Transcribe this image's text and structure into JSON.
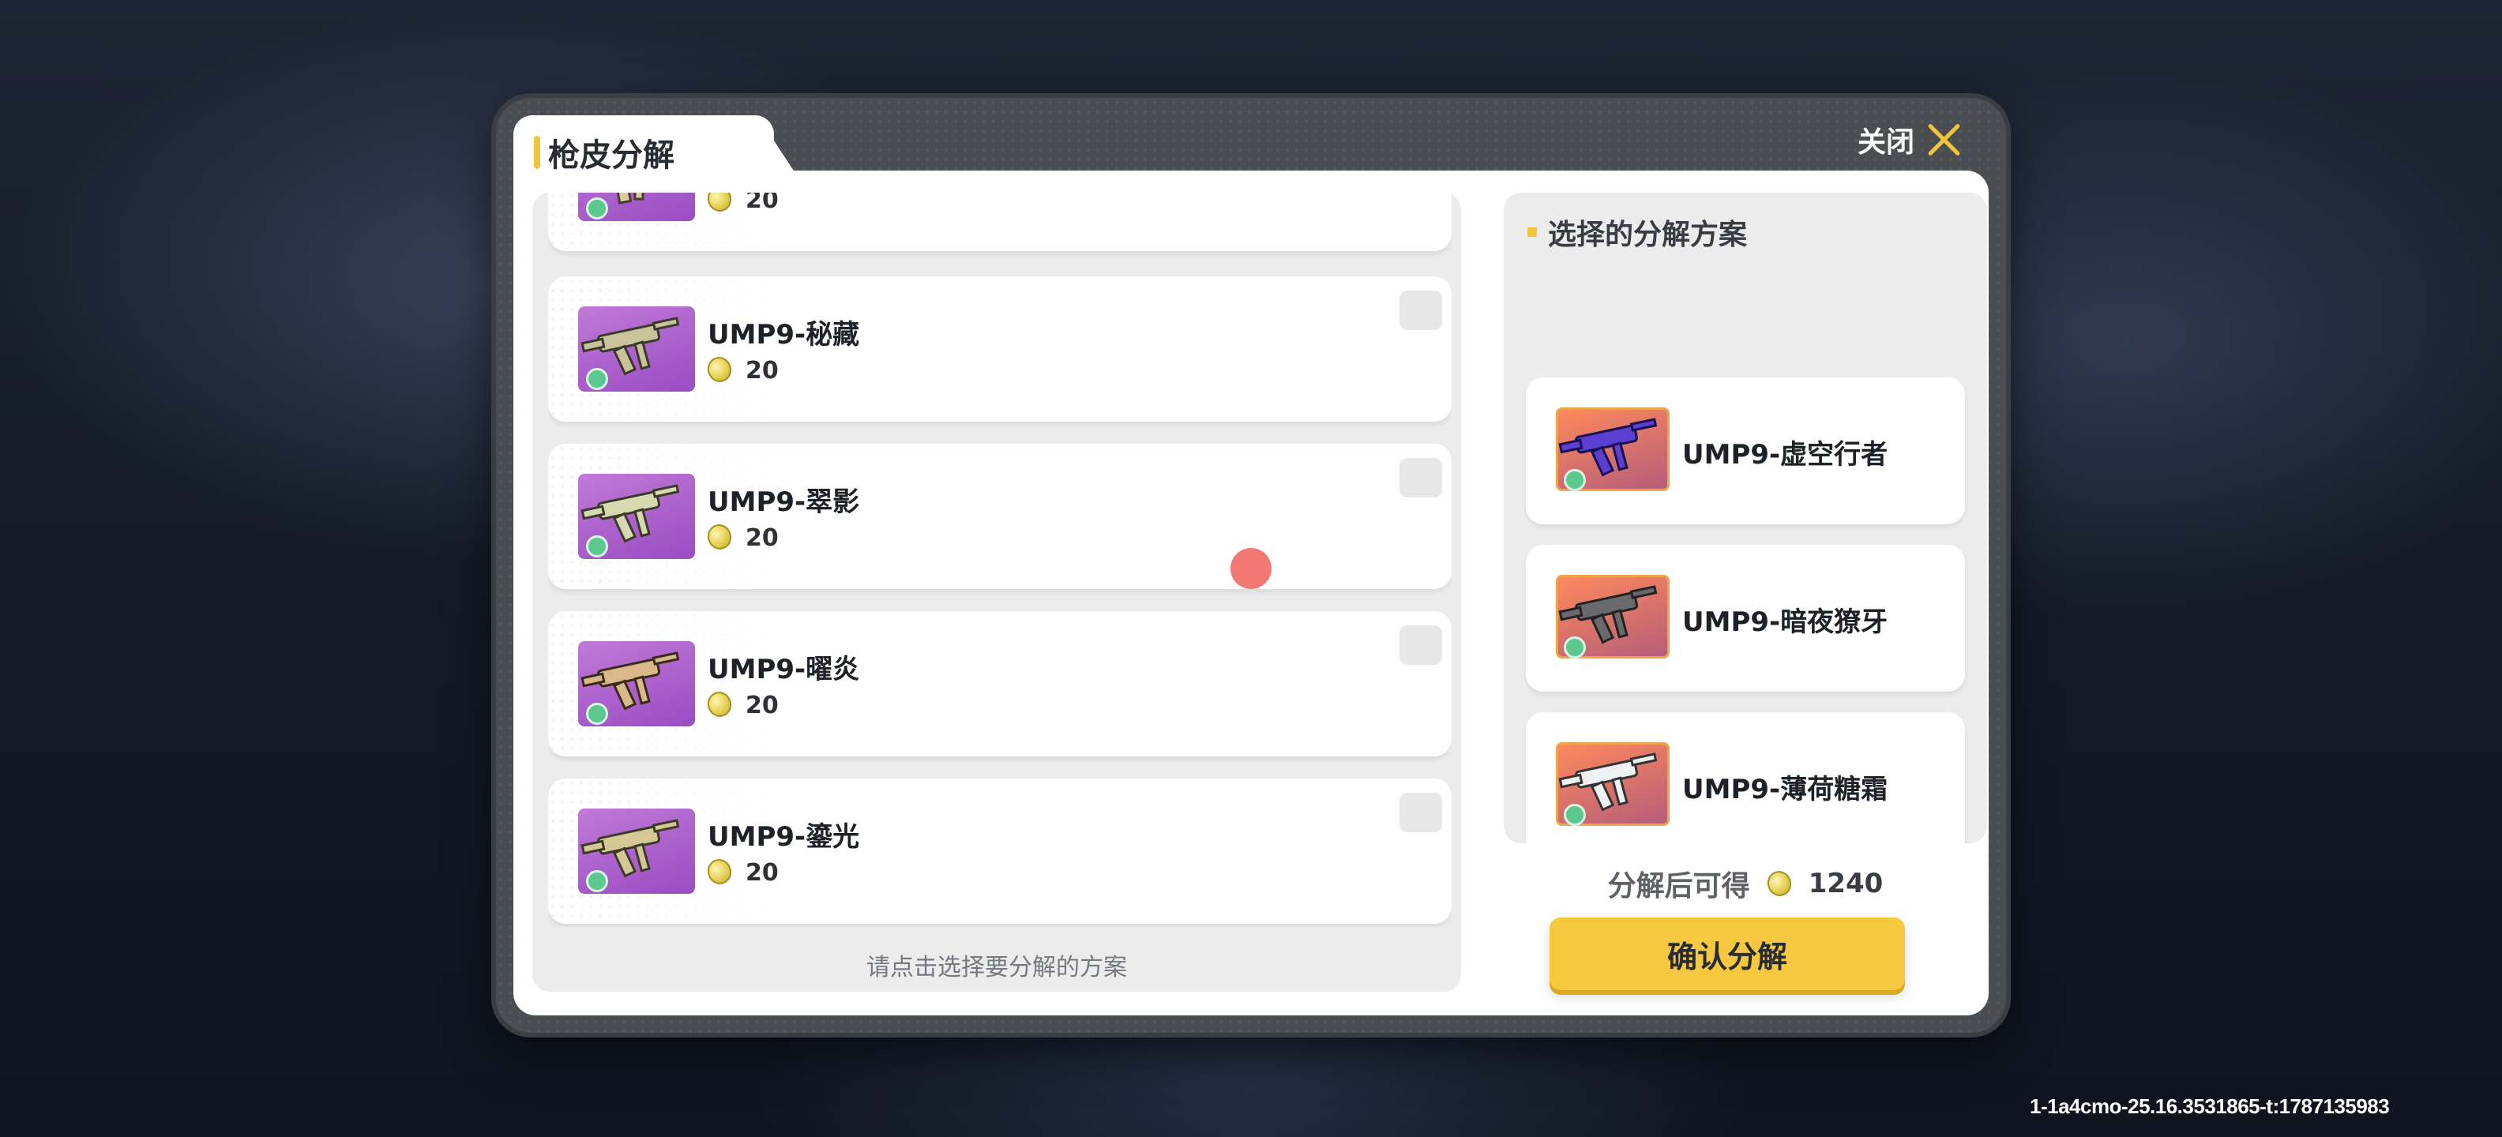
{
  "dialog": {
    "title": "枪皮分解",
    "close_label": "关闭"
  },
  "skin_list": {
    "items": [
      {
        "name": "",
        "price": "20",
        "icon": "gun-skin-thumb"
      },
      {
        "name": "UMP9-秘藏",
        "price": "20",
        "icon": "gun-skin-thumb"
      },
      {
        "name": "UMP9-翠影",
        "price": "20",
        "icon": "gun-skin-thumb"
      },
      {
        "name": "UMP9-曜炎",
        "price": "20",
        "icon": "gun-skin-thumb"
      },
      {
        "name": "UMP9-鎏光",
        "price": "20",
        "icon": "gun-skin-thumb"
      }
    ],
    "hint": "请点击选择要分解的方案"
  },
  "selected_plan": {
    "title": "选择的分解方案",
    "items": [
      {
        "name": "UMP9-虚空行者"
      },
      {
        "name": "UMP9-暗夜獠牙"
      },
      {
        "name": "UMP9-薄荷糖霜"
      }
    ]
  },
  "result": {
    "label": "分解后可得",
    "value": "1240",
    "icon": "coin-icon"
  },
  "confirm_label": "确认分解",
  "build_id": "1-1a4cmo-25.16.3531865-t:1787135983",
  "colors": {
    "accent": "#f3c53a",
    "button": "#f5c840",
    "rarity_purple": "#9a4cc2",
    "rarity_orange": "#f0a34a"
  }
}
